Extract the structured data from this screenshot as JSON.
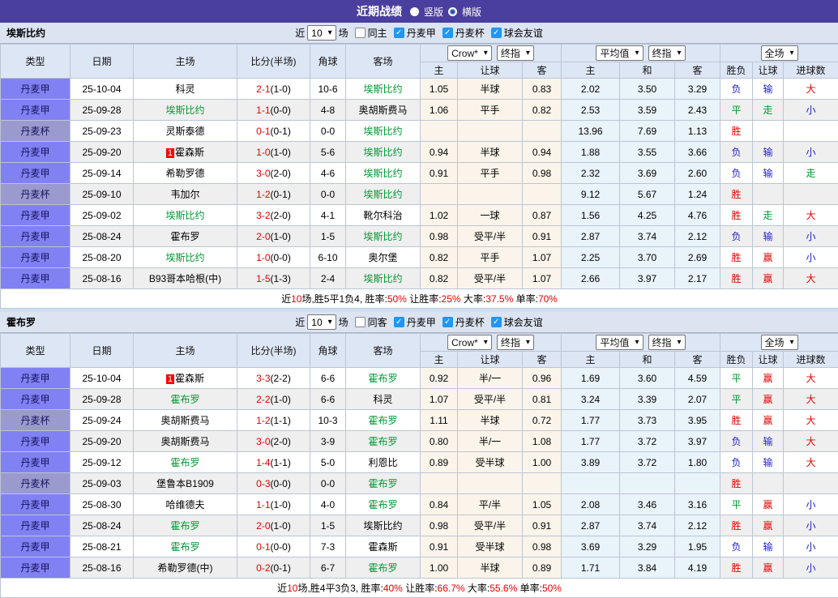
{
  "title_bar": {
    "title": "近期战绩",
    "radios": [
      {
        "label": "竖版",
        "selected": true
      },
      {
        "label": "横版",
        "selected": false
      }
    ]
  },
  "controls": {
    "near": "近",
    "games": "10",
    "games_suffix": "场",
    "leagues": [
      "丹麦甲",
      "丹麦杯",
      "球会友谊"
    ]
  },
  "table_headers": {
    "type": "类型",
    "date": "日期",
    "home": "主场",
    "score": "比分(半场)",
    "corner": "角球",
    "away": "客场",
    "crow_select": "Crow*",
    "crow_final": "终指",
    "avg_select": "平均值",
    "avg_final": "终指",
    "scope_select": "全场",
    "sub": [
      "主",
      "让球",
      "客",
      "主",
      "和",
      "客",
      "胜负",
      "让球",
      "进球数"
    ]
  },
  "colors": {
    "accent_purple": "#4a3e9e",
    "league_jia_bg": "#8181f3",
    "league_bei_bg": "#9a9ace",
    "focus_team_green": "#009933",
    "score_red": "#e60000",
    "result_blue": "#2121d2",
    "crow_bg": "#fbf4ea",
    "avg_bg": "#e9f3fa",
    "checkbox_blue": "#2196f3"
  },
  "sections": [
    {
      "team": "埃斯比约",
      "same_label": "同主",
      "rows": [
        {
          "type": "丹麦甲",
          "type_style": "jia",
          "date": "25-10-04",
          "home": {
            "name": "科灵",
            "focus": false,
            "badge": ""
          },
          "score_ft": "2-1",
          "score_ht": "(1-0)",
          "corner": "10-6",
          "away": {
            "name": "埃斯比约",
            "focus": true,
            "badge": ""
          },
          "crow": [
            "1.05",
            "半球",
            "0.83"
          ],
          "avg": [
            "2.02",
            "3.50",
            "3.29"
          ],
          "results": [
            {
              "t": "负",
              "c": "b"
            },
            {
              "t": "输",
              "c": "b"
            },
            {
              "t": "大",
              "c": "r"
            }
          ]
        },
        {
          "type": "丹麦甲",
          "type_style": "jia",
          "date": "25-09-28",
          "home": {
            "name": "埃斯比约",
            "focus": true,
            "badge": ""
          },
          "score_ft": "1-1",
          "score_ht": "(0-0)",
          "corner": "4-8",
          "away": {
            "name": "奥胡斯费马",
            "focus": false,
            "badge": ""
          },
          "crow": [
            "1.06",
            "平手",
            "0.82"
          ],
          "avg": [
            "2.53",
            "3.59",
            "2.43"
          ],
          "results": [
            {
              "t": "平",
              "c": "g"
            },
            {
              "t": "走",
              "c": "g"
            },
            {
              "t": "小",
              "c": "b"
            }
          ]
        },
        {
          "type": "丹麦杯",
          "type_style": "bei",
          "date": "25-09-23",
          "home": {
            "name": "灵斯泰德",
            "focus": false,
            "badge": ""
          },
          "score_ft": "0-1",
          "score_ht": "(0-1)",
          "corner": "0-0",
          "away": {
            "name": "埃斯比约",
            "focus": true,
            "badge": ""
          },
          "crow": [
            "",
            "",
            ""
          ],
          "avg": [
            "13.96",
            "7.69",
            "1.13"
          ],
          "results": [
            {
              "t": "胜",
              "c": "r"
            },
            {
              "t": "",
              "c": "k"
            },
            {
              "t": "",
              "c": "k"
            }
          ]
        },
        {
          "type": "丹麦甲",
          "type_style": "jia",
          "date": "25-09-20",
          "home": {
            "name": "霍森斯",
            "focus": false,
            "badge": "1"
          },
          "score_ft": "1-0",
          "score_ht": "(1-0)",
          "corner": "5-6",
          "away": {
            "name": "埃斯比约",
            "focus": true,
            "badge": ""
          },
          "crow": [
            "0.94",
            "半球",
            "0.94"
          ],
          "avg": [
            "1.88",
            "3.55",
            "3.66"
          ],
          "results": [
            {
              "t": "负",
              "c": "b"
            },
            {
              "t": "输",
              "c": "b"
            },
            {
              "t": "小",
              "c": "b"
            }
          ]
        },
        {
          "type": "丹麦甲",
          "type_style": "jia",
          "date": "25-09-14",
          "home": {
            "name": "希勒罗德",
            "focus": false,
            "badge": ""
          },
          "score_ft": "3-0",
          "score_ht": "(2-0)",
          "corner": "4-6",
          "away": {
            "name": "埃斯比约",
            "focus": true,
            "badge": ""
          },
          "crow": [
            "0.91",
            "平手",
            "0.98"
          ],
          "avg": [
            "2.32",
            "3.69",
            "2.60"
          ],
          "results": [
            {
              "t": "负",
              "c": "b"
            },
            {
              "t": "输",
              "c": "b"
            },
            {
              "t": "走",
              "c": "g"
            }
          ]
        },
        {
          "type": "丹麦杯",
          "type_style": "bei",
          "date": "25-09-10",
          "home": {
            "name": "韦加尔",
            "focus": false,
            "badge": ""
          },
          "score_ft": "1-2",
          "score_ht": "(0-1)",
          "corner": "0-0",
          "away": {
            "name": "埃斯比约",
            "focus": true,
            "badge": ""
          },
          "crow": [
            "",
            "",
            ""
          ],
          "avg": [
            "9.12",
            "5.67",
            "1.24"
          ],
          "results": [
            {
              "t": "胜",
              "c": "r"
            },
            {
              "t": "",
              "c": "k"
            },
            {
              "t": "",
              "c": "k"
            }
          ]
        },
        {
          "type": "丹麦甲",
          "type_style": "jia",
          "date": "25-09-02",
          "home": {
            "name": "埃斯比约",
            "focus": true,
            "badge": ""
          },
          "score_ft": "3-2",
          "score_ht": "(2-0)",
          "corner": "4-1",
          "away": {
            "name": "靴尔科治",
            "focus": false,
            "badge": ""
          },
          "crow": [
            "1.02",
            "一球",
            "0.87"
          ],
          "avg": [
            "1.56",
            "4.25",
            "4.76"
          ],
          "results": [
            {
              "t": "胜",
              "c": "r"
            },
            {
              "t": "走",
              "c": "g"
            },
            {
              "t": "大",
              "c": "r"
            }
          ]
        },
        {
          "type": "丹麦甲",
          "type_style": "jia",
          "date": "25-08-24",
          "home": {
            "name": "霍布罗",
            "focus": false,
            "badge": ""
          },
          "score_ft": "2-0",
          "score_ht": "(1-0)",
          "corner": "1-5",
          "away": {
            "name": "埃斯比约",
            "focus": true,
            "badge": ""
          },
          "crow": [
            "0.98",
            "受平/半",
            "0.91"
          ],
          "avg": [
            "2.87",
            "3.74",
            "2.12"
          ],
          "results": [
            {
              "t": "负",
              "c": "b"
            },
            {
              "t": "输",
              "c": "b"
            },
            {
              "t": "小",
              "c": "b"
            }
          ]
        },
        {
          "type": "丹麦甲",
          "type_style": "jia",
          "date": "25-08-20",
          "home": {
            "name": "埃斯比约",
            "focus": true,
            "badge": ""
          },
          "score_ft": "1-0",
          "score_ht": "(0-0)",
          "corner": "6-10",
          "away": {
            "name": "奥尔堡",
            "focus": false,
            "badge": ""
          },
          "crow": [
            "0.82",
            "平手",
            "1.07"
          ],
          "avg": [
            "2.25",
            "3.70",
            "2.69"
          ],
          "results": [
            {
              "t": "胜",
              "c": "r"
            },
            {
              "t": "赢",
              "c": "r"
            },
            {
              "t": "小",
              "c": "b"
            }
          ]
        },
        {
          "type": "丹麦甲",
          "type_style": "jia",
          "date": "25-08-16",
          "home": {
            "name": "B93哥本哈根(中)",
            "focus": false,
            "badge": ""
          },
          "score_ft": "1-5",
          "score_ht": "(1-3)",
          "corner": "2-4",
          "away": {
            "name": "埃斯比约",
            "focus": true,
            "badge": ""
          },
          "crow": [
            "0.82",
            "受平/半",
            "1.07"
          ],
          "avg": [
            "2.66",
            "3.97",
            "2.17"
          ],
          "results": [
            {
              "t": "胜",
              "c": "r"
            },
            {
              "t": "赢",
              "c": "r"
            },
            {
              "t": "大",
              "c": "r"
            }
          ]
        }
      ],
      "summary": [
        {
          "t": "近",
          "c": "k"
        },
        {
          "t": "10",
          "c": "r"
        },
        {
          "t": "场,胜5平1负4, 胜率:",
          "c": "k"
        },
        {
          "t": "50%",
          "c": "r"
        },
        {
          "t": " 让胜率:",
          "c": "k"
        },
        {
          "t": "25%",
          "c": "r"
        },
        {
          "t": " 大率:",
          "c": "k"
        },
        {
          "t": "37.5%",
          "c": "r"
        },
        {
          "t": " 单率:",
          "c": "k"
        },
        {
          "t": "70%",
          "c": "r"
        }
      ]
    },
    {
      "team": "霍布罗",
      "same_label": "同客",
      "rows": [
        {
          "type": "丹麦甲",
          "type_style": "jia",
          "date": "25-10-04",
          "home": {
            "name": "霍森斯",
            "focus": false,
            "badge": "1"
          },
          "score_ft": "3-3",
          "score_ht": "(2-2)",
          "corner": "6-6",
          "away": {
            "name": "霍布罗",
            "focus": true,
            "badge": ""
          },
          "crow": [
            "0.92",
            "半/一",
            "0.96"
          ],
          "avg": [
            "1.69",
            "3.60",
            "4.59"
          ],
          "results": [
            {
              "t": "平",
              "c": "g"
            },
            {
              "t": "赢",
              "c": "r"
            },
            {
              "t": "大",
              "c": "r"
            }
          ]
        },
        {
          "type": "丹麦甲",
          "type_style": "jia",
          "date": "25-09-28",
          "home": {
            "name": "霍布罗",
            "focus": true,
            "badge": ""
          },
          "score_ft": "2-2",
          "score_ht": "(1-0)",
          "corner": "6-6",
          "away": {
            "name": "科灵",
            "focus": false,
            "badge": ""
          },
          "crow": [
            "1.07",
            "受平/半",
            "0.81"
          ],
          "avg": [
            "3.24",
            "3.39",
            "2.07"
          ],
          "results": [
            {
              "t": "平",
              "c": "g"
            },
            {
              "t": "赢",
              "c": "r"
            },
            {
              "t": "大",
              "c": "r"
            }
          ]
        },
        {
          "type": "丹麦杯",
          "type_style": "bei",
          "date": "25-09-24",
          "home": {
            "name": "奥胡斯费马",
            "focus": false,
            "badge": ""
          },
          "score_ft": "1-2",
          "score_ht": "(1-1)",
          "corner": "10-3",
          "away": {
            "name": "霍布罗",
            "focus": true,
            "badge": ""
          },
          "crow": [
            "1.11",
            "半球",
            "0.72"
          ],
          "avg": [
            "1.77",
            "3.73",
            "3.95"
          ],
          "results": [
            {
              "t": "胜",
              "c": "r"
            },
            {
              "t": "赢",
              "c": "r"
            },
            {
              "t": "大",
              "c": "r"
            }
          ]
        },
        {
          "type": "丹麦甲",
          "type_style": "jia",
          "date": "25-09-20",
          "home": {
            "name": "奥胡斯费马",
            "focus": false,
            "badge": ""
          },
          "score_ft": "3-0",
          "score_ht": "(2-0)",
          "corner": "3-9",
          "away": {
            "name": "霍布罗",
            "focus": true,
            "badge": ""
          },
          "crow": [
            "0.80",
            "半/一",
            "1.08"
          ],
          "avg": [
            "1.77",
            "3.72",
            "3.97"
          ],
          "results": [
            {
              "t": "负",
              "c": "b"
            },
            {
              "t": "输",
              "c": "b"
            },
            {
              "t": "大",
              "c": "r"
            }
          ]
        },
        {
          "type": "丹麦甲",
          "type_style": "jia",
          "date": "25-09-12",
          "home": {
            "name": "霍布罗",
            "focus": true,
            "badge": ""
          },
          "score_ft": "1-4",
          "score_ht": "(1-1)",
          "corner": "5-0",
          "away": {
            "name": "利恩比",
            "focus": false,
            "badge": ""
          },
          "crow": [
            "0.89",
            "受半球",
            "1.00"
          ],
          "avg": [
            "3.89",
            "3.72",
            "1.80"
          ],
          "results": [
            {
              "t": "负",
              "c": "b"
            },
            {
              "t": "输",
              "c": "b"
            },
            {
              "t": "大",
              "c": "r"
            }
          ]
        },
        {
          "type": "丹麦杯",
          "type_style": "bei",
          "date": "25-09-03",
          "home": {
            "name": "堡鲁本B1909",
            "focus": false,
            "badge": ""
          },
          "score_ft": "0-3",
          "score_ht": "(0-0)",
          "corner": "0-0",
          "away": {
            "name": "霍布罗",
            "focus": true,
            "badge": ""
          },
          "crow": [
            "",
            "",
            ""
          ],
          "avg": [
            "",
            "",
            ""
          ],
          "results": [
            {
              "t": "胜",
              "c": "r"
            },
            {
              "t": "",
              "c": "k"
            },
            {
              "t": "",
              "c": "k"
            }
          ]
        },
        {
          "type": "丹麦甲",
          "type_style": "jia",
          "date": "25-08-30",
          "home": {
            "name": "哈维德夫",
            "focus": false,
            "badge": ""
          },
          "score_ft": "1-1",
          "score_ht": "(1-0)",
          "corner": "4-0",
          "away": {
            "name": "霍布罗",
            "focus": true,
            "badge": ""
          },
          "crow": [
            "0.84",
            "平/半",
            "1.05"
          ],
          "avg": [
            "2.08",
            "3.46",
            "3.16"
          ],
          "results": [
            {
              "t": "平",
              "c": "g"
            },
            {
              "t": "赢",
              "c": "r"
            },
            {
              "t": "小",
              "c": "b"
            }
          ]
        },
        {
          "type": "丹麦甲",
          "type_style": "jia",
          "date": "25-08-24",
          "home": {
            "name": "霍布罗",
            "focus": true,
            "badge": ""
          },
          "score_ft": "2-0",
          "score_ht": "(1-0)",
          "corner": "1-5",
          "away": {
            "name": "埃斯比约",
            "focus": false,
            "badge": ""
          },
          "crow": [
            "0.98",
            "受平/半",
            "0.91"
          ],
          "avg": [
            "2.87",
            "3.74",
            "2.12"
          ],
          "results": [
            {
              "t": "胜",
              "c": "r"
            },
            {
              "t": "赢",
              "c": "r"
            },
            {
              "t": "小",
              "c": "b"
            }
          ]
        },
        {
          "type": "丹麦甲",
          "type_style": "jia",
          "date": "25-08-21",
          "home": {
            "name": "霍布罗",
            "focus": true,
            "badge": ""
          },
          "score_ft": "0-1",
          "score_ht": "(0-0)",
          "corner": "7-3",
          "away": {
            "name": "霍森斯",
            "focus": false,
            "badge": ""
          },
          "crow": [
            "0.91",
            "受半球",
            "0.98"
          ],
          "avg": [
            "3.69",
            "3.29",
            "1.95"
          ],
          "results": [
            {
              "t": "负",
              "c": "b"
            },
            {
              "t": "输",
              "c": "b"
            },
            {
              "t": "小",
              "c": "b"
            }
          ]
        },
        {
          "type": "丹麦甲",
          "type_style": "jia",
          "date": "25-08-16",
          "home": {
            "name": "希勒罗德(中)",
            "focus": false,
            "badge": ""
          },
          "score_ft": "0-2",
          "score_ht": "(0-1)",
          "corner": "6-7",
          "away": {
            "name": "霍布罗",
            "focus": true,
            "badge": ""
          },
          "crow": [
            "1.00",
            "半球",
            "0.89"
          ],
          "avg": [
            "1.71",
            "3.84",
            "4.19"
          ],
          "results": [
            {
              "t": "胜",
              "c": "r"
            },
            {
              "t": "赢",
              "c": "r"
            },
            {
              "t": "小",
              "c": "b"
            }
          ]
        }
      ],
      "summary": [
        {
          "t": "近",
          "c": "k"
        },
        {
          "t": "10",
          "c": "r"
        },
        {
          "t": "场,胜4平3负3, 胜率:",
          "c": "k"
        },
        {
          "t": "40%",
          "c": "r"
        },
        {
          "t": " 让胜率:",
          "c": "k"
        },
        {
          "t": "66.7%",
          "c": "r"
        },
        {
          "t": " 大率:",
          "c": "k"
        },
        {
          "t": "55.6%",
          "c": "r"
        },
        {
          "t": " 单率:",
          "c": "k"
        },
        {
          "t": "50%",
          "c": "r"
        }
      ]
    }
  ]
}
